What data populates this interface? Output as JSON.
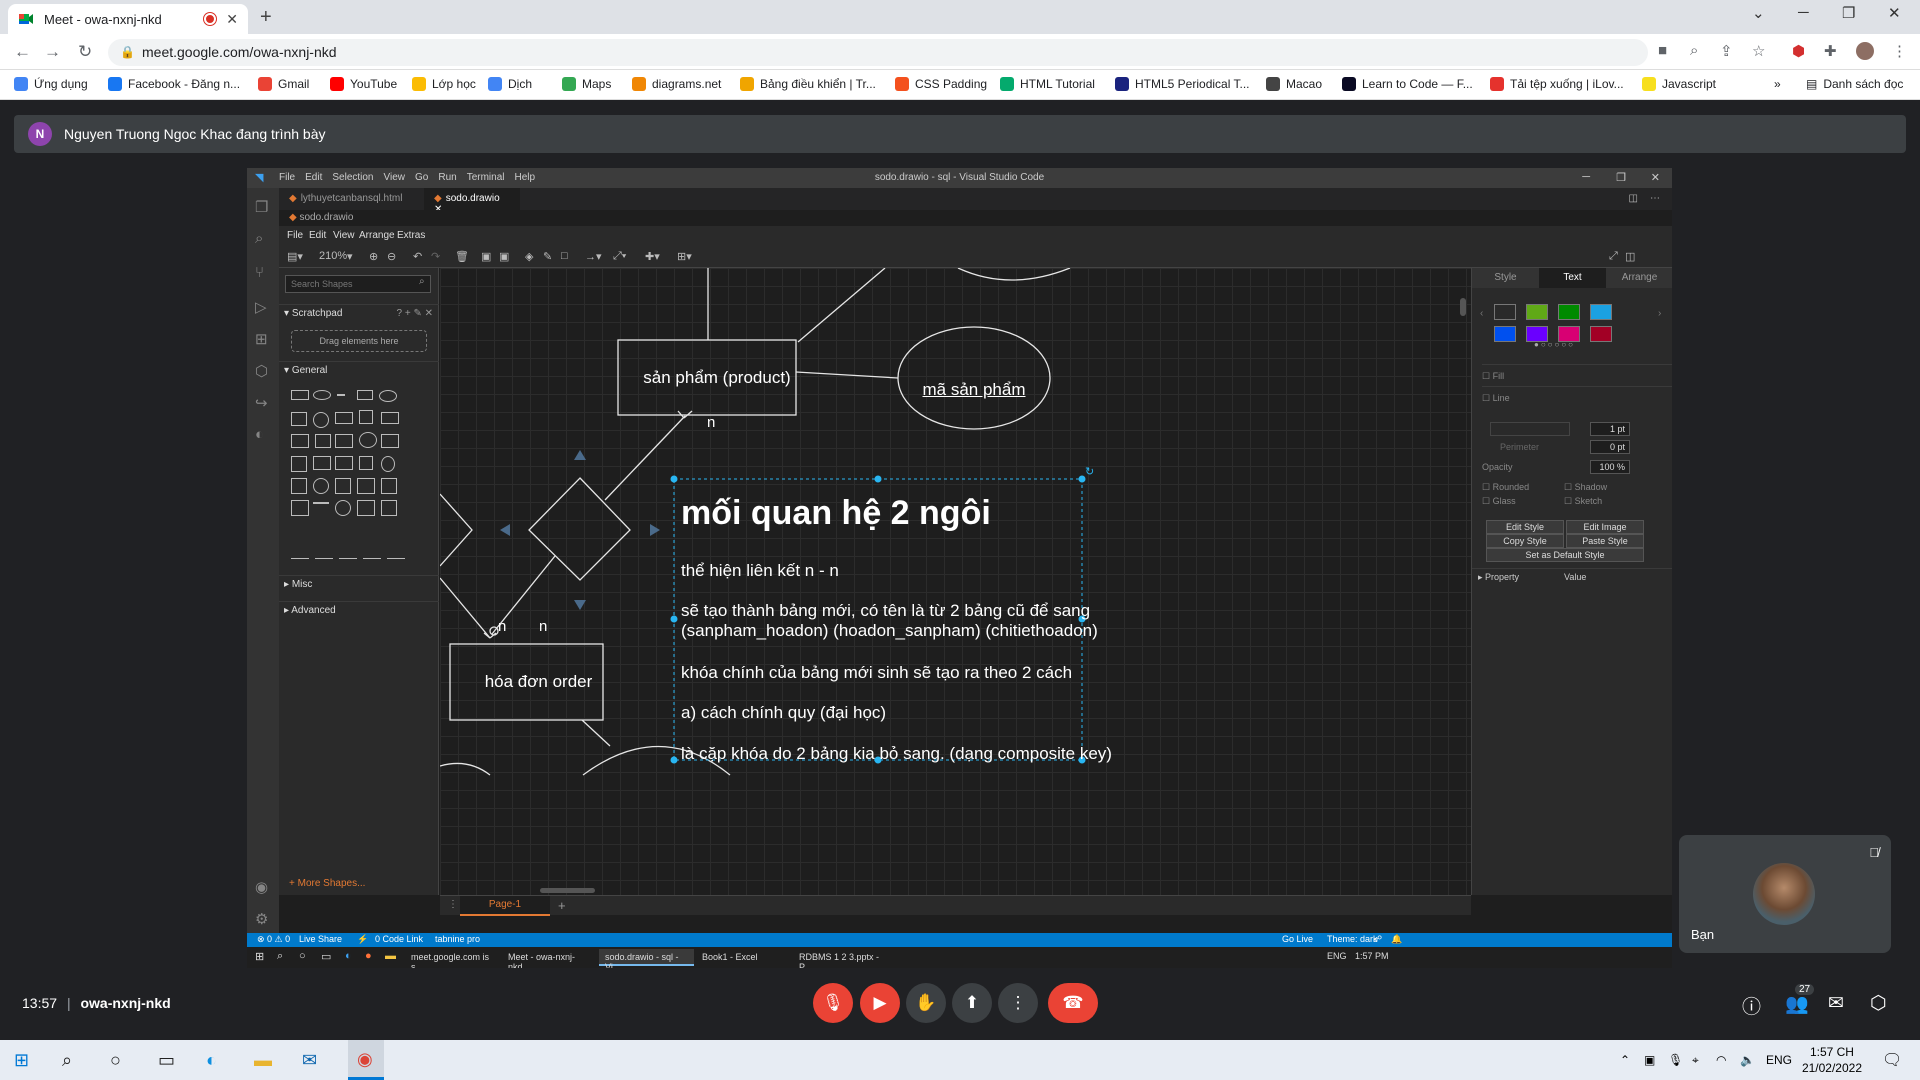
{
  "chrome": {
    "tab_title": "Meet - owa-nxnj-nkd",
    "url": "meet.google.com/owa-nxnj-nkd",
    "bookmarks": [
      {
        "label": "Ứng dụng",
        "color": "#4285f4"
      },
      {
        "label": "Facebook - Đăng n...",
        "color": "#1877f2"
      },
      {
        "label": "Gmail",
        "color": "#ea4335"
      },
      {
        "label": "YouTube",
        "color": "#ff0000"
      },
      {
        "label": "Lớp học",
        "color": "#fbbc04"
      },
      {
        "label": "Dịch",
        "color": "#4285f4"
      },
      {
        "label": "Maps",
        "color": "#34a853"
      },
      {
        "label": "diagrams.net",
        "color": "#f08705"
      },
      {
        "label": "Bảng điều khiển | Tr...",
        "color": "#f0a500"
      },
      {
        "label": "CSS Padding",
        "color": "#f4511e"
      },
      {
        "label": "HTML Tutorial",
        "color": "#04aa6d"
      },
      {
        "label": "HTML5 Periodical T...",
        "color": "#1a237e"
      },
      {
        "label": "Macao",
        "color": "#444444"
      },
      {
        "label": "Learn to Code — F...",
        "color": "#0a0a23"
      },
      {
        "label": "Tải tệp xuống | iLov...",
        "color": "#e5322d"
      },
      {
        "label": "Javascript",
        "color": "#f7df1e"
      }
    ],
    "bookmarks_more": "»",
    "reading_list": "Danh sách đọc"
  },
  "meet": {
    "presenter_initial": "N",
    "presenter_text": "Nguyen Truong Ngoc Khac đang trình bày",
    "self_name": "Bạn",
    "time": "13:57",
    "separator": "|",
    "meeting_code": "owa-nxnj-nkd",
    "participants_count": "27"
  },
  "vscode": {
    "menu": [
      "File",
      "Edit",
      "Selection",
      "View",
      "Go",
      "Run",
      "Terminal",
      "Help"
    ],
    "window_title": "sodo.drawio - sql - Visual Studio Code",
    "tabs": [
      {
        "label": "lythuyetcanbansql.html",
        "active": false
      },
      {
        "label": "sodo.drawio",
        "active": true
      }
    ],
    "breadcrumb": "sodo.drawio",
    "status": {
      "errors": "⊗ 0 ⚠ 0",
      "live_share": "Live Share",
      "code_link": "0 Code Link",
      "tabnine": "tabnine pro",
      "go_live": "Go Live",
      "theme": "Theme: dark"
    }
  },
  "drawio": {
    "menu": [
      "File",
      "Edit",
      "View",
      "Arrange",
      "Extras"
    ],
    "zoom": "210%",
    "search_placeholder": "Search Shapes",
    "scratchpad_label": "Scratchpad",
    "scratchpad_drop": "Drag elements here",
    "general_label": "General",
    "misc_label": "Misc",
    "advanced_label": "Advanced",
    "more_shapes": "+ More Shapes...",
    "page_tab": "Page-1",
    "format_tabs": [
      "Style",
      "Text",
      "Arrange"
    ],
    "fill_label": "Fill",
    "line_label": "Line",
    "line_width": "1 pt",
    "perimeter_label": "Perimeter",
    "perimeter_value": "0 pt",
    "opacity_label": "Opacity",
    "opacity_value": "100 %",
    "rounded_label": "Rounded",
    "shadow_label": "Shadow",
    "glass_label": "Glass",
    "sketch_label": "Sketch",
    "buttons": [
      "Edit Style",
      "Edit Image",
      "Copy Style",
      "Paste Style",
      "Set as Default Style"
    ],
    "property_label": "Property",
    "value_label": "Value",
    "swatch_colors": [
      "#2a2a2a",
      "#60a917",
      "#008a00",
      "#1ba1e2",
      "#0050ef",
      "#6a00ff",
      "#d80073",
      "#a20025"
    ]
  },
  "diagram": {
    "product_box": "sản phẩm (product)",
    "product_attr": "mã sản phẩm",
    "order_box": "hóa đơn order",
    "card_n1": "n",
    "card_n2": "n",
    "card_n3": "n",
    "title": "mối quan hệ 2 ngôi",
    "lines": [
      "thể hiện liên kết  n - n",
      "sẽ tạo thành bảng mới, có tên là từ 2 bảng cũ để sang",
      "(sanpham_hoadon) (hoadon_sanpham)  (chitiethoadon)",
      "khóa chính của bảng mới sinh sẽ tạo ra theo 2 cách",
      "a) cách chính quy (đại học)",
      "là cặp khóa do 2 bảng kia bỏ sang. (dạng composite key)"
    ]
  },
  "inner_taskbar": {
    "items": [
      "meet.google.com is s...",
      "Meet - owa-nxnj-nkd...",
      "sodo.drawio - sql - Vi...",
      "Book1 - Excel",
      "RDBMS 1 2 3.pptx - P..."
    ],
    "lang": "ENG",
    "clock": "1:57 PM"
  },
  "win_taskbar": {
    "lang": "ENG",
    "time": "1:57 CH",
    "date": "21/02/2022"
  }
}
